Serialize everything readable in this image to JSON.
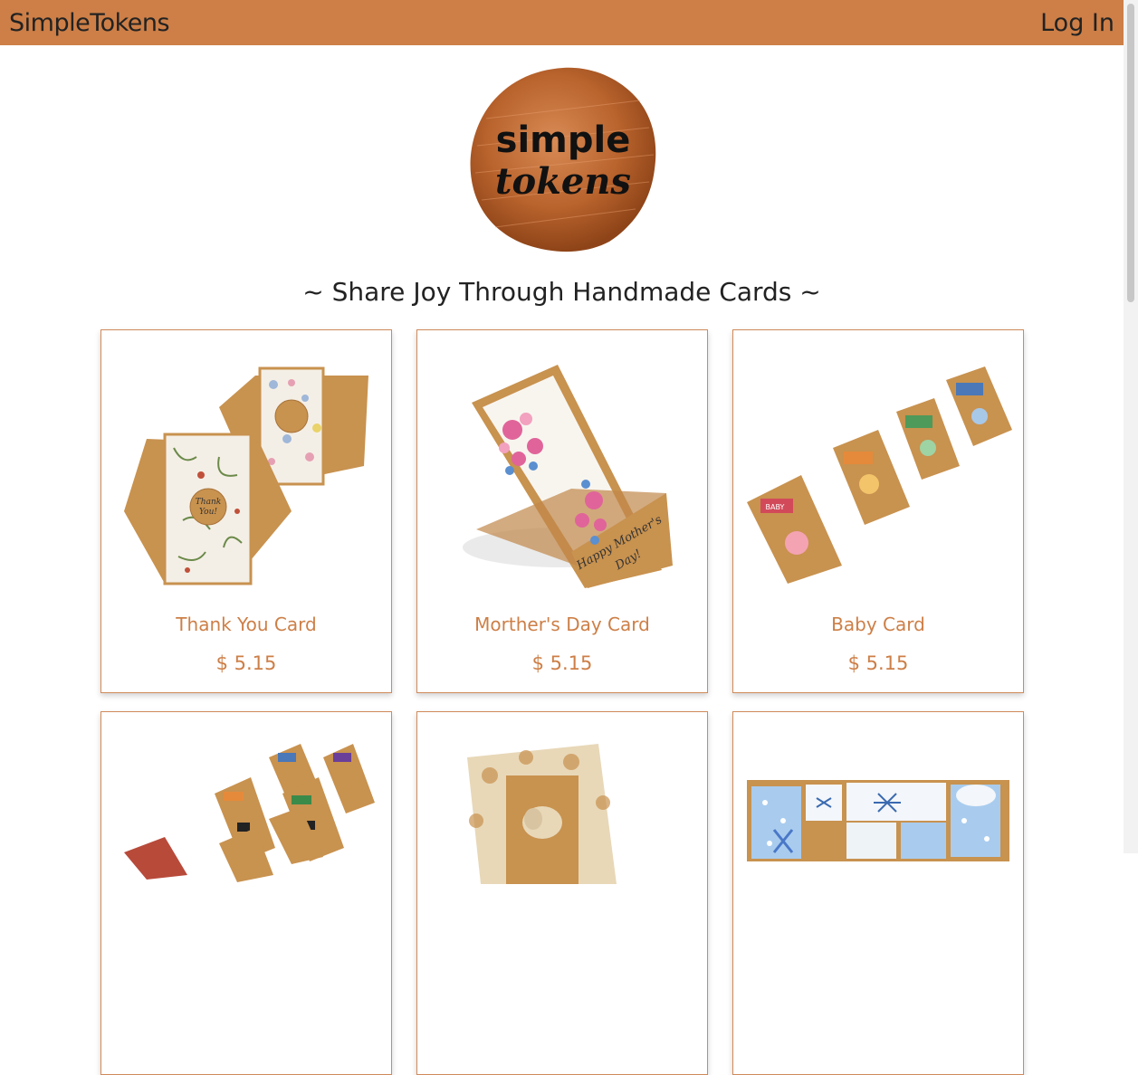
{
  "navbar": {
    "brand": "SimpleTokens",
    "login_label": "Log In",
    "color": "#cd7f47"
  },
  "logo": {
    "line1": "simple",
    "line2": "tokens"
  },
  "tagline": "~ Share Joy Through Handmade Cards ~",
  "products": [
    {
      "name": "Thank You Card",
      "price": "$ 5.15",
      "art_text": [
        "Thank",
        "You!"
      ]
    },
    {
      "name": "Morther's Day Card",
      "price": "$ 5.15",
      "art_text": [
        "Happy Mother's",
        "Day!"
      ]
    },
    {
      "name": "Baby Card",
      "price": "$ 5.15",
      "art_text": [
        "BABY"
      ]
    },
    {
      "name": "",
      "price": ""
    },
    {
      "name": "",
      "price": ""
    },
    {
      "name": "",
      "price": ""
    }
  ]
}
